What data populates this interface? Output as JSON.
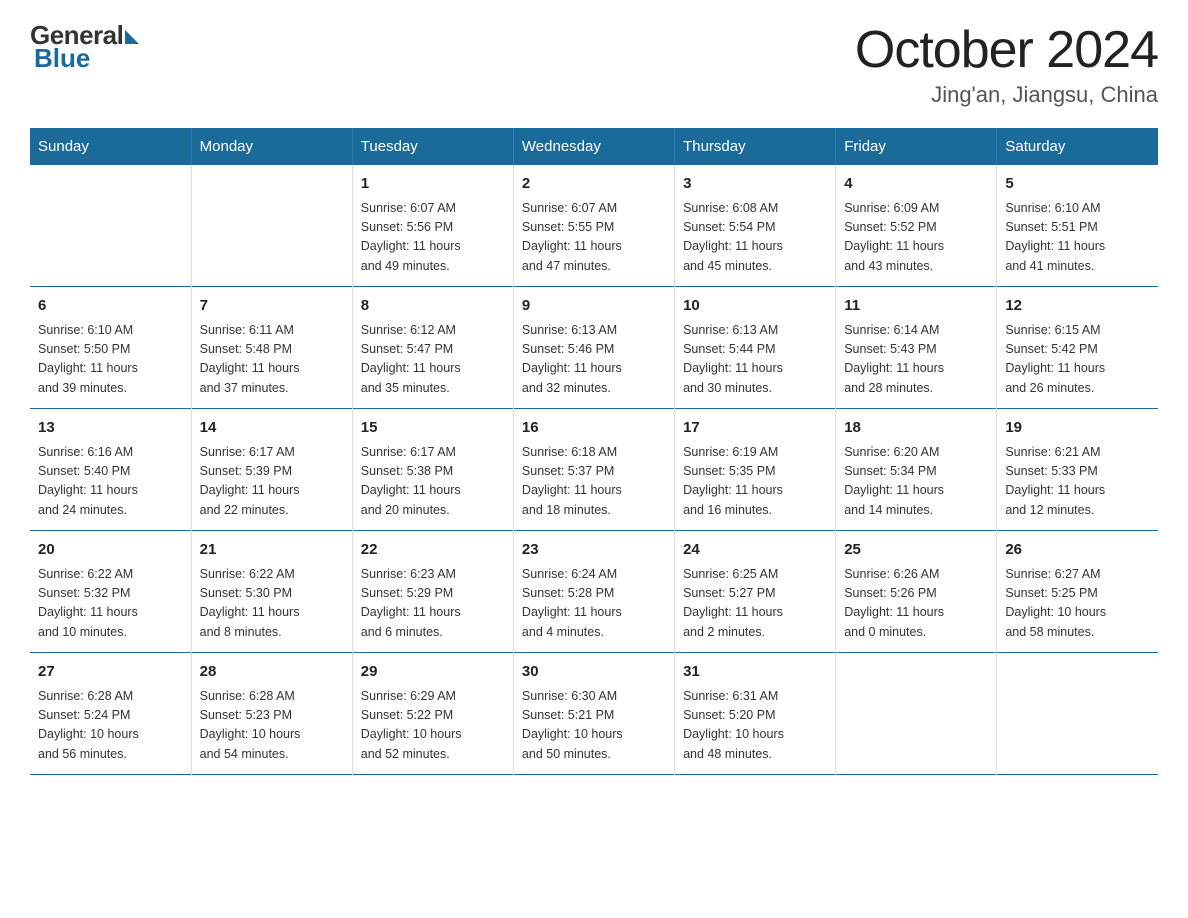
{
  "logo": {
    "general": "General",
    "blue": "Blue"
  },
  "title": "October 2024",
  "location": "Jing'an, Jiangsu, China",
  "weekdays": [
    "Sunday",
    "Monday",
    "Tuesday",
    "Wednesday",
    "Thursday",
    "Friday",
    "Saturday"
  ],
  "weeks": [
    [
      {
        "day": "",
        "info": ""
      },
      {
        "day": "",
        "info": ""
      },
      {
        "day": "1",
        "info": "Sunrise: 6:07 AM\nSunset: 5:56 PM\nDaylight: 11 hours\nand 49 minutes."
      },
      {
        "day": "2",
        "info": "Sunrise: 6:07 AM\nSunset: 5:55 PM\nDaylight: 11 hours\nand 47 minutes."
      },
      {
        "day": "3",
        "info": "Sunrise: 6:08 AM\nSunset: 5:54 PM\nDaylight: 11 hours\nand 45 minutes."
      },
      {
        "day": "4",
        "info": "Sunrise: 6:09 AM\nSunset: 5:52 PM\nDaylight: 11 hours\nand 43 minutes."
      },
      {
        "day": "5",
        "info": "Sunrise: 6:10 AM\nSunset: 5:51 PM\nDaylight: 11 hours\nand 41 minutes."
      }
    ],
    [
      {
        "day": "6",
        "info": "Sunrise: 6:10 AM\nSunset: 5:50 PM\nDaylight: 11 hours\nand 39 minutes."
      },
      {
        "day": "7",
        "info": "Sunrise: 6:11 AM\nSunset: 5:48 PM\nDaylight: 11 hours\nand 37 minutes."
      },
      {
        "day": "8",
        "info": "Sunrise: 6:12 AM\nSunset: 5:47 PM\nDaylight: 11 hours\nand 35 minutes."
      },
      {
        "day": "9",
        "info": "Sunrise: 6:13 AM\nSunset: 5:46 PM\nDaylight: 11 hours\nand 32 minutes."
      },
      {
        "day": "10",
        "info": "Sunrise: 6:13 AM\nSunset: 5:44 PM\nDaylight: 11 hours\nand 30 minutes."
      },
      {
        "day": "11",
        "info": "Sunrise: 6:14 AM\nSunset: 5:43 PM\nDaylight: 11 hours\nand 28 minutes."
      },
      {
        "day": "12",
        "info": "Sunrise: 6:15 AM\nSunset: 5:42 PM\nDaylight: 11 hours\nand 26 minutes."
      }
    ],
    [
      {
        "day": "13",
        "info": "Sunrise: 6:16 AM\nSunset: 5:40 PM\nDaylight: 11 hours\nand 24 minutes."
      },
      {
        "day": "14",
        "info": "Sunrise: 6:17 AM\nSunset: 5:39 PM\nDaylight: 11 hours\nand 22 minutes."
      },
      {
        "day": "15",
        "info": "Sunrise: 6:17 AM\nSunset: 5:38 PM\nDaylight: 11 hours\nand 20 minutes."
      },
      {
        "day": "16",
        "info": "Sunrise: 6:18 AM\nSunset: 5:37 PM\nDaylight: 11 hours\nand 18 minutes."
      },
      {
        "day": "17",
        "info": "Sunrise: 6:19 AM\nSunset: 5:35 PM\nDaylight: 11 hours\nand 16 minutes."
      },
      {
        "day": "18",
        "info": "Sunrise: 6:20 AM\nSunset: 5:34 PM\nDaylight: 11 hours\nand 14 minutes."
      },
      {
        "day": "19",
        "info": "Sunrise: 6:21 AM\nSunset: 5:33 PM\nDaylight: 11 hours\nand 12 minutes."
      }
    ],
    [
      {
        "day": "20",
        "info": "Sunrise: 6:22 AM\nSunset: 5:32 PM\nDaylight: 11 hours\nand 10 minutes."
      },
      {
        "day": "21",
        "info": "Sunrise: 6:22 AM\nSunset: 5:30 PM\nDaylight: 11 hours\nand 8 minutes."
      },
      {
        "day": "22",
        "info": "Sunrise: 6:23 AM\nSunset: 5:29 PM\nDaylight: 11 hours\nand 6 minutes."
      },
      {
        "day": "23",
        "info": "Sunrise: 6:24 AM\nSunset: 5:28 PM\nDaylight: 11 hours\nand 4 minutes."
      },
      {
        "day": "24",
        "info": "Sunrise: 6:25 AM\nSunset: 5:27 PM\nDaylight: 11 hours\nand 2 minutes."
      },
      {
        "day": "25",
        "info": "Sunrise: 6:26 AM\nSunset: 5:26 PM\nDaylight: 11 hours\nand 0 minutes."
      },
      {
        "day": "26",
        "info": "Sunrise: 6:27 AM\nSunset: 5:25 PM\nDaylight: 10 hours\nand 58 minutes."
      }
    ],
    [
      {
        "day": "27",
        "info": "Sunrise: 6:28 AM\nSunset: 5:24 PM\nDaylight: 10 hours\nand 56 minutes."
      },
      {
        "day": "28",
        "info": "Sunrise: 6:28 AM\nSunset: 5:23 PM\nDaylight: 10 hours\nand 54 minutes."
      },
      {
        "day": "29",
        "info": "Sunrise: 6:29 AM\nSunset: 5:22 PM\nDaylight: 10 hours\nand 52 minutes."
      },
      {
        "day": "30",
        "info": "Sunrise: 6:30 AM\nSunset: 5:21 PM\nDaylight: 10 hours\nand 50 minutes."
      },
      {
        "day": "31",
        "info": "Sunrise: 6:31 AM\nSunset: 5:20 PM\nDaylight: 10 hours\nand 48 minutes."
      },
      {
        "day": "",
        "info": ""
      },
      {
        "day": "",
        "info": ""
      }
    ]
  ]
}
